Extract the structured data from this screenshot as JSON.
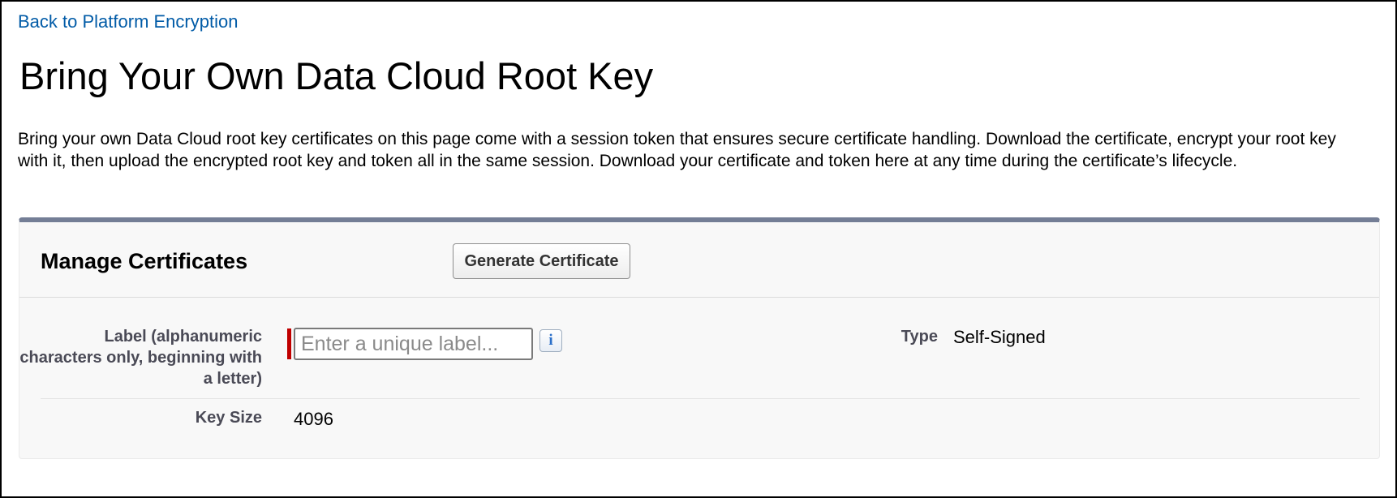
{
  "nav": {
    "back_link": "Back to Platform Encryption"
  },
  "page": {
    "title": "Bring Your Own Data Cloud Root Key",
    "description": "Bring your own Data Cloud root key certificates on this page come with a session token that ensures secure certificate handling. Download the certificate, encrypt your root key with it, then upload the encrypted root key and token all in the same session. Download your certificate and token here at any time during the certificate’s lifecycle."
  },
  "panel": {
    "title": "Manage Certificates",
    "generate_button": "Generate Certificate",
    "fields": {
      "label": {
        "label": "Label (alphanumeric characters only, beginning with a letter)",
        "placeholder": "Enter a unique label...",
        "value": "",
        "required": true,
        "info_icon": "info-icon"
      },
      "type": {
        "label": "Type",
        "value": "Self-Signed"
      },
      "key_size": {
        "label": "Key Size",
        "value": "4096"
      }
    }
  },
  "colors": {
    "link": "#015ba7",
    "panel_top_border": "#747e96",
    "required_marker": "#c00000",
    "field_label": "#4a4a56"
  }
}
